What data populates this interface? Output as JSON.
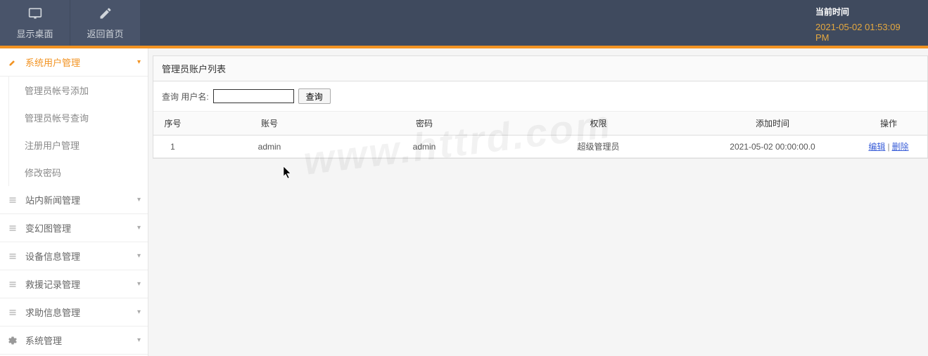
{
  "header": {
    "show_desktop": "显示桌面",
    "back_home": "返回首页",
    "time_label": "当前时间",
    "time_value": "2021-05-02 01:53:09 PM"
  },
  "sidebar": {
    "items": [
      {
        "label": "系统用户管理",
        "active": true
      },
      {
        "label": "站内新闻管理",
        "active": false
      },
      {
        "label": "变幻图管理",
        "active": false
      },
      {
        "label": "设备信息管理",
        "active": false
      },
      {
        "label": "救援记录管理",
        "active": false
      },
      {
        "label": "求助信息管理",
        "active": false
      },
      {
        "label": "系统管理",
        "active": false
      }
    ],
    "subitems": [
      {
        "label": "管理员帐号添加"
      },
      {
        "label": "管理员帐号查询"
      },
      {
        "label": "注册用户管理"
      },
      {
        "label": "修改密码"
      }
    ]
  },
  "panel": {
    "title": "管理员账户列表",
    "search_label": "查询 用户名:",
    "search_value": "",
    "search_button": "查询",
    "columns": {
      "index": "序号",
      "account": "账号",
      "password": "密码",
      "role": "权限",
      "addtime": "添加时间",
      "operation": "操作"
    },
    "rows": [
      {
        "index": "1",
        "account": "admin",
        "password": "admin",
        "role": "超级管理员",
        "addtime": "2021-05-02 00:00:00.0",
        "edit": "编辑",
        "delete": "删除"
      }
    ]
  },
  "watermark": "www.httrd.com"
}
